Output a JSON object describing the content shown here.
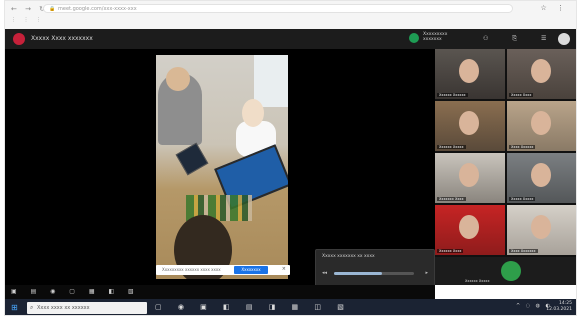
{
  "browser": {
    "nav_icons": "← → ↻",
    "url": "meet.google.com/xxx-xxxx-xxx",
    "lock": "🔒",
    "row2": "⋮ ⋮ ⋮",
    "right_icons": "☆ ⋮"
  },
  "meeting": {
    "title": "Xxxxx Xxxx xxxxxxx",
    "recording": [
      "Xxxxxxxxx",
      "xxxxxxx"
    ],
    "tools": "⚇ ⎘ ☰",
    "accent": "#1e9c54"
  },
  "stage": {
    "infobar": {
      "message": "Xxxxxxxxx xxxxxx xxxx xxxx",
      "button": "Xxxxxxxx",
      "close": "×"
    },
    "popup": {
      "title": "Xxxxx xxxxxxx xx xxxx",
      "left_icon": "◂◂",
      "right_icon": "▸",
      "footer": "▪ ▪ ▪ ▪"
    },
    "controls": "▣ ▤ ◉ ▢ ▦ ◧ ▧"
  },
  "participants": [
    {
      "label": "Xxxxxx Xxxxxx"
    },
    {
      "label": "Xxxxx Xxxx"
    },
    {
      "label": "Xxxxxx Xxxxx"
    },
    {
      "label": "Xxxx Xxxxxx"
    },
    {
      "label": "Xxxxxxx Xxxx"
    },
    {
      "label": "Xxxxx Xxxxx"
    },
    {
      "label": "Xxxxxx Xxxx"
    },
    {
      "label": "Xxxx Xxxxxxx"
    }
  ],
  "recording_tile": {
    "label": "Xxxxxx Xxxxx"
  },
  "taskbar": {
    "start": "⊞",
    "search_icon": "⌕",
    "search_placeholder": "Xxxx xxxx xx xxxxxx",
    "apps": "▢ ◉ ▣ ◧ ▤ ◨ ▦ ◫ ▧",
    "tray": "^ ◌ ◍ ◐",
    "time": "14:25",
    "date": "12.03.2021"
  }
}
